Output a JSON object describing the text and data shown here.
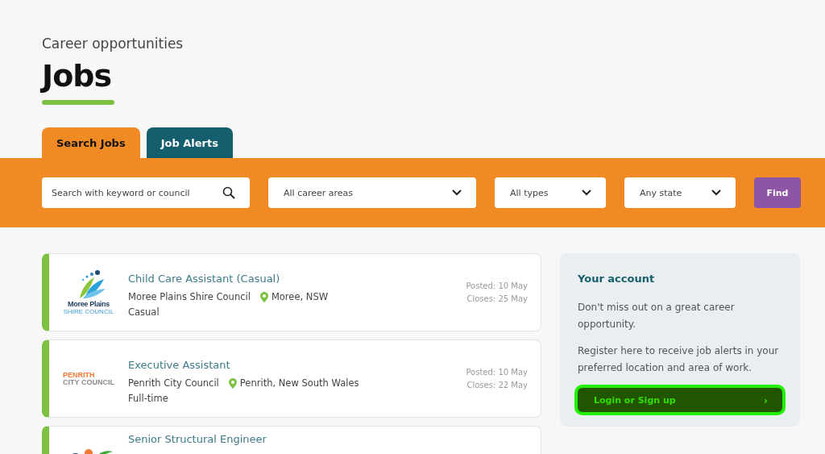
{
  "header": {
    "eyebrow": "Career opportunities",
    "title": "Jobs"
  },
  "tabs": [
    {
      "label": "Search Jobs",
      "selected": true
    },
    {
      "label": "Job Alerts",
      "selected": false
    }
  ],
  "search": {
    "placeholder": "Search with keyword or council"
  },
  "filters": [
    {
      "value": "All career areas"
    },
    {
      "value": "All types"
    },
    {
      "value": "Any state"
    }
  ],
  "find_button": "Find",
  "jobs": [
    {
      "kind": "moree",
      "logo_text": [
        "Moree Plains",
        "SHIRE COUNCIL"
      ],
      "title": "Child Care Assistant (Casual)",
      "employer": "Moree Plains Shire Council",
      "location": "Moree, NSW",
      "type": "Casual",
      "posted": "Posted: 10 May",
      "closes": "Closes: 25 May"
    },
    {
      "kind": "penrith",
      "logo_text": [
        "PENRITH",
        "CITY COUNCIL"
      ],
      "title": "Executive Assistant",
      "employer": "Penrith City Council",
      "location": "Penrith, New South Wales",
      "type": "Full-time",
      "posted": "Posted: 10 May",
      "closes": "Closes: 22 May"
    },
    {
      "kind": "swoosh",
      "title": "Senior Structural Engineer"
    }
  ],
  "account": {
    "title": "Your account",
    "paragraphs": [
      "Don't miss out on a great career opportunity.",
      "Register here to receive job alerts in your preferred location and area of work."
    ],
    "button": "Login or Sign up",
    "button_icon": "›"
  }
}
